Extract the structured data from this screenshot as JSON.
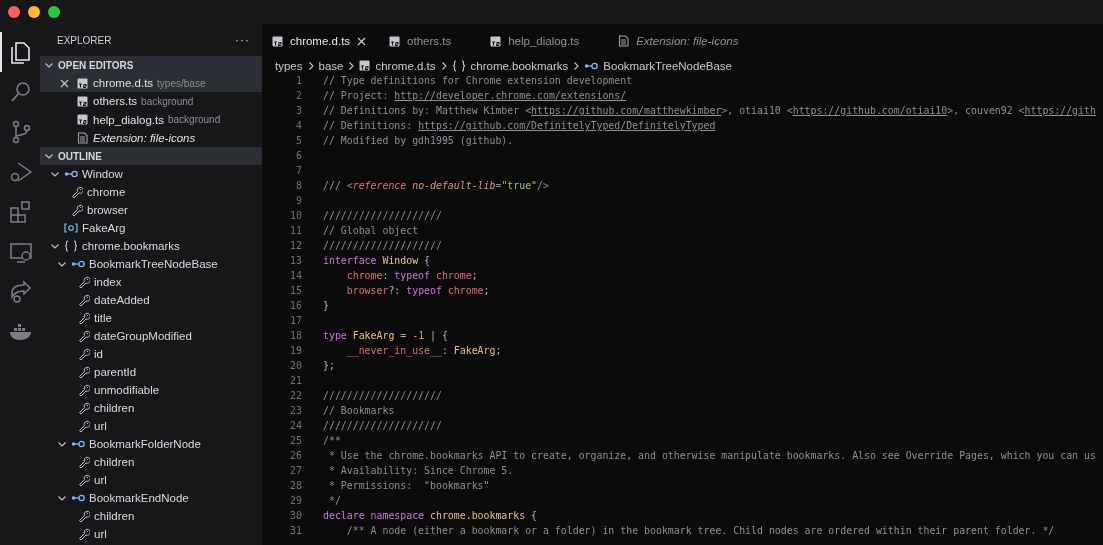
{
  "activity_bar": {
    "items": [
      {
        "kind": "files",
        "selected": true
      },
      {
        "kind": "search",
        "selected": false
      },
      {
        "kind": "source-control",
        "selected": false
      },
      {
        "kind": "debug",
        "selected": false
      },
      {
        "kind": "extensions",
        "selected": false
      },
      {
        "kind": "remote",
        "selected": false
      },
      {
        "kind": "share",
        "selected": false
      },
      {
        "kind": "docker",
        "selected": false
      }
    ]
  },
  "sidebar": {
    "title": "EXPLORER",
    "more": "···",
    "open_editors": {
      "title": "OPEN EDITORS",
      "expanded": true,
      "items": [
        {
          "kind": "ts",
          "name": "chrome.d.ts",
          "description": "types/base",
          "selected": true
        },
        {
          "kind": "ts",
          "name": "others.ts",
          "description": "background",
          "selected": false
        },
        {
          "kind": "ts",
          "name": "help_dialog.ts",
          "description": "background",
          "selected": false
        },
        {
          "kind": "preview",
          "name": "Extension: file-icons",
          "selected": false
        }
      ]
    },
    "outline": {
      "title": "OUTLINE",
      "expanded": true,
      "items": [
        {
          "kind": "interface",
          "label": "Window",
          "expanded": true,
          "children": [
            {
              "kind": "property",
              "label": "chrome"
            },
            {
              "kind": "property",
              "label": "browser"
            }
          ]
        },
        {
          "kind": "type",
          "label": "FakeArg"
        },
        {
          "kind": "namespace",
          "label": "chrome.bookmarks",
          "expanded": true,
          "children": [
            {
              "kind": "interface",
              "label": "BookmarkTreeNodeBase",
              "expanded": true,
              "children": [
                {
                  "kind": "property",
                  "label": "index"
                },
                {
                  "kind": "property",
                  "label": "dateAdded"
                },
                {
                  "kind": "property",
                  "label": "title"
                },
                {
                  "kind": "property",
                  "label": "dateGroupModified"
                },
                {
                  "kind": "property",
                  "label": "id"
                },
                {
                  "kind": "property",
                  "label": "parentId"
                },
                {
                  "kind": "property",
                  "label": "unmodifiable"
                },
                {
                  "kind": "property",
                  "label": "children"
                },
                {
                  "kind": "property",
                  "label": "url"
                }
              ]
            },
            {
              "kind": "interface",
              "label": "BookmarkFolderNode",
              "expanded": true,
              "children": [
                {
                  "kind": "property",
                  "label": "children"
                },
                {
                  "kind": "property",
                  "label": "url"
                }
              ]
            },
            {
              "kind": "interface",
              "label": "BookmarkEndNode",
              "expanded": true,
              "children": [
                {
                  "kind": "property",
                  "label": "children"
                },
                {
                  "kind": "property",
                  "label": "url"
                }
              ]
            }
          ]
        }
      ]
    }
  },
  "tabs": [
    {
      "kind": "ts",
      "label": "chrome.d.ts",
      "selected": true
    },
    {
      "kind": "ts",
      "label": "others.ts",
      "selected": false
    },
    {
      "kind": "ts",
      "label": "help_dialog.ts",
      "selected": false
    },
    {
      "kind": "preview",
      "label": "Extension: file-icons",
      "selected": false
    }
  ],
  "breadcrumb": [
    {
      "kind": "folder",
      "label": "types"
    },
    {
      "kind": "folder",
      "label": "base"
    },
    {
      "kind": "ts",
      "label": "chrome.d.ts"
    },
    {
      "kind": "namespace",
      "label": "chrome.bookmarks"
    },
    {
      "kind": "interface",
      "label": "BookmarkTreeNodeBase"
    }
  ],
  "editor": {
    "lines": [
      {
        "number": "1",
        "tokens": [
          {
            "kind": "comment",
            "text": "// Type definitions for Chrome extension development"
          }
        ]
      },
      {
        "number": "2",
        "tokens": [
          {
            "kind": "comment",
            "text": "// Project: "
          },
          {
            "kind": "link",
            "text": "http://developer.chrome.com/extensions/"
          }
        ]
      },
      {
        "number": "3",
        "tokens": [
          {
            "kind": "comment",
            "text": "// Definitions by: Matthew Kimber <"
          },
          {
            "kind": "link",
            "text": "https://github.com/matthewkimber"
          },
          {
            "kind": "comment",
            "text": ">, otiai10 <"
          },
          {
            "kind": "link",
            "text": "https://github.com/otiai10"
          },
          {
            "kind": "comment",
            "text": ">, couven92 <"
          },
          {
            "kind": "link",
            "text": "https://gith"
          }
        ]
      },
      {
        "number": "4",
        "tokens": [
          {
            "kind": "comment",
            "text": "// Definitions: "
          },
          {
            "kind": "link",
            "text": "https://github.com/DefinitelyTyped/DefinitelyTyped"
          }
        ]
      },
      {
        "number": "5",
        "tokens": [
          {
            "kind": "comment",
            "text": "// Modified by gdh1995 (github)."
          }
        ]
      },
      {
        "number": "6"
      },
      {
        "number": "7"
      },
      {
        "number": "8",
        "tokens": [
          {
            "kind": "comment",
            "text": "/// <"
          },
          {
            "kind": "tag",
            "text": "reference"
          },
          {
            "kind": "attr",
            "text": " no-default-lib"
          },
          {
            "kind": "comment",
            "text": "="
          },
          {
            "kind": "string",
            "text": "\"true\""
          },
          {
            "kind": "comment",
            "text": "/>"
          }
        ]
      },
      {
        "number": "9"
      },
      {
        "number": "10",
        "tokens": [
          {
            "kind": "comment",
            "text": "////////////////////"
          }
        ]
      },
      {
        "number": "11",
        "tokens": [
          {
            "kind": "comment",
            "text": "// Global object"
          }
        ]
      },
      {
        "number": "12",
        "tokens": [
          {
            "kind": "comment",
            "text": "////////////////////"
          }
        ]
      },
      {
        "number": "13",
        "tokens": [
          {
            "kind": "keyword",
            "text": "interface"
          },
          {
            "kind": "type",
            "text": " Window"
          },
          {
            "kind": "plain",
            "text": " {"
          }
        ]
      },
      {
        "number": "14",
        "tokens": [
          {
            "kind": "prop",
            "text": "    chrome"
          },
          {
            "kind": "plain",
            "text": ": "
          },
          {
            "kind": "keyword",
            "text": "typeof"
          },
          {
            "kind": "prop",
            "text": " chrome"
          },
          {
            "kind": "plain",
            "text": ";"
          }
        ]
      },
      {
        "number": "15",
        "tokens": [
          {
            "kind": "prop",
            "text": "    browser"
          },
          {
            "kind": "plain",
            "text": "?: "
          },
          {
            "kind": "keyword",
            "text": "typeof"
          },
          {
            "kind": "prop",
            "text": " chrome"
          },
          {
            "kind": "plain",
            "text": ";"
          }
        ]
      },
      {
        "number": "16",
        "tokens": [
          {
            "kind": "plain",
            "text": "}"
          }
        ]
      },
      {
        "number": "17"
      },
      {
        "number": "18",
        "tokens": [
          {
            "kind": "keyword",
            "text": "type"
          },
          {
            "kind": "type",
            "text": " FakeArg"
          },
          {
            "kind": "plain",
            "text": " = "
          },
          {
            "kind": "number",
            "text": "-1"
          },
          {
            "kind": "plain",
            "text": " | {"
          }
        ]
      },
      {
        "number": "19",
        "tokens": [
          {
            "kind": "prop",
            "text": "    __never_in_use__"
          },
          {
            "kind": "plain",
            "text": ": "
          },
          {
            "kind": "type",
            "text": "FakeArg"
          },
          {
            "kind": "plain",
            "text": ";"
          }
        ]
      },
      {
        "number": "20",
        "tokens": [
          {
            "kind": "plain",
            "text": "};"
          }
        ]
      },
      {
        "number": "21"
      },
      {
        "number": "22",
        "tokens": [
          {
            "kind": "comment",
            "text": "////////////////////"
          }
        ]
      },
      {
        "number": "23",
        "tokens": [
          {
            "kind": "comment",
            "text": "// Bookmarks"
          }
        ]
      },
      {
        "number": "24",
        "tokens": [
          {
            "kind": "comment",
            "text": "////////////////////"
          }
        ]
      },
      {
        "number": "25",
        "tokens": [
          {
            "kind": "comment",
            "text": "/**"
          }
        ]
      },
      {
        "number": "26",
        "tokens": [
          {
            "kind": "comment",
            "text": " * Use the chrome.bookmarks API to create, organize, and otherwise manipulate bookmarks. Also see Override Pages, which you can us"
          }
        ]
      },
      {
        "number": "27",
        "tokens": [
          {
            "kind": "comment",
            "text": " * Availability: Since Chrome 5."
          }
        ]
      },
      {
        "number": "28",
        "tokens": [
          {
            "kind": "comment",
            "text": " * Permissions:  \"bookmarks\""
          }
        ]
      },
      {
        "number": "29",
        "tokens": [
          {
            "kind": "comment",
            "text": " */"
          }
        ]
      },
      {
        "number": "30",
        "tokens": [
          {
            "kind": "keyword",
            "text": "declare namespace"
          },
          {
            "kind": "type",
            "text": " chrome.bookmarks"
          },
          {
            "kind": "plain",
            "text": " {"
          }
        ]
      },
      {
        "number": "31",
        "tokens": [
          {
            "kind": "comment",
            "text": "    /** A node (either a bookmark or a folder) in the bookmark tree. Child nodes are ordered within their parent folder. */"
          }
        ]
      }
    ]
  }
}
